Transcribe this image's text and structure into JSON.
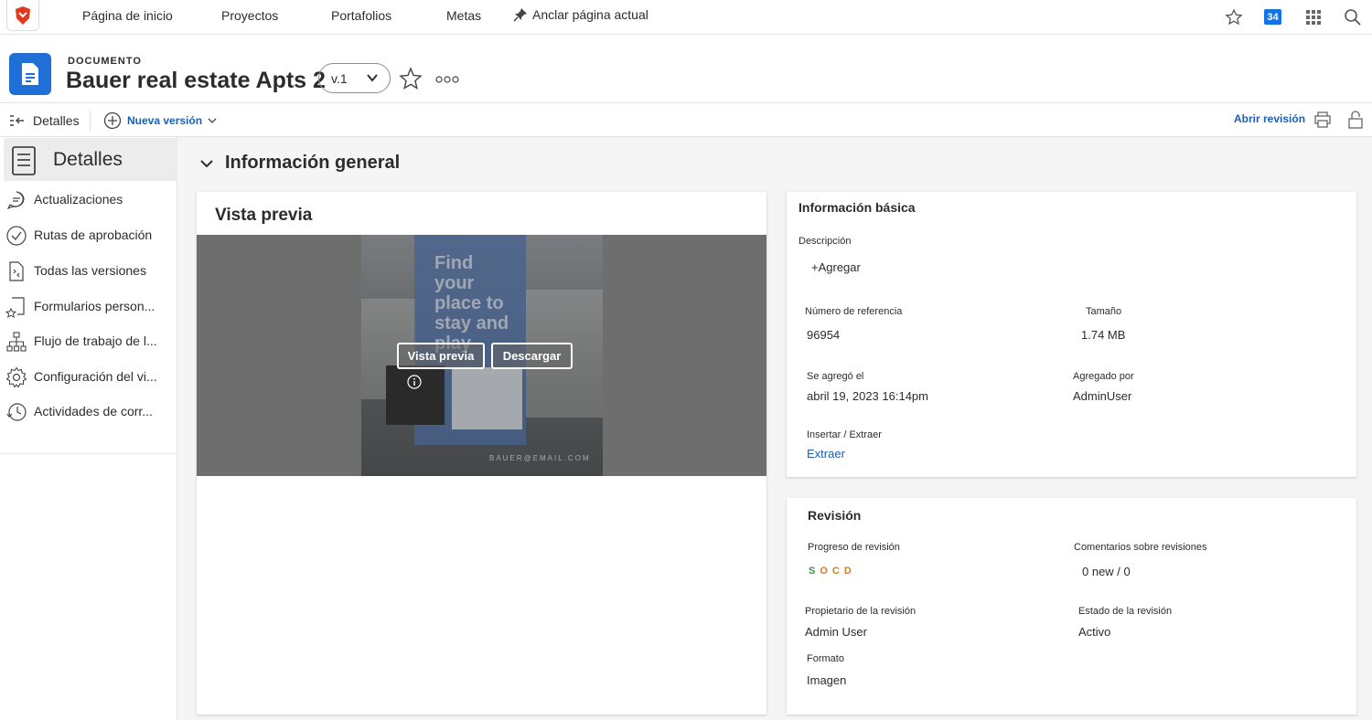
{
  "topnav": {
    "items": [
      "Página de inicio",
      "Proyectos",
      "Portafolios",
      "Metas"
    ],
    "pin_label": "Anclar página actual",
    "badge_count": "34"
  },
  "header": {
    "object_type": "DOCUMENTO",
    "title": "Bauer real estate Apts 2",
    "version": "v.1"
  },
  "toolbar": {
    "details_label": "Detalles",
    "new_version_label": "Nueva versión",
    "open_review_label": "Abrir revisión"
  },
  "sidebar": {
    "active_label": "Detalles",
    "items": [
      {
        "label": "Actualizaciones",
        "icon": "comment-icon"
      },
      {
        "label": "Rutas de aprobación",
        "icon": "check-circle-icon"
      },
      {
        "label": "Todas las versiones",
        "icon": "file-versions-icon"
      },
      {
        "label": "Formularios person...",
        "icon": "custom-form-icon"
      },
      {
        "label": "Flujo de trabajo de l...",
        "icon": "workflow-icon"
      },
      {
        "label": "Configuración del vi...",
        "icon": "gear-icon"
      },
      {
        "label": "Actividades de corr...",
        "icon": "history-icon"
      }
    ]
  },
  "main": {
    "section_title": "Información general",
    "preview": {
      "title": "Vista previa",
      "headline": "Find your place to stay and play",
      "email": "BAUER@EMAIL.COM",
      "preview_button": "Vista previa",
      "download_button": "Descargar"
    },
    "basic_info": {
      "title": "Información básica",
      "description_label": "Descripción",
      "add_label": "+Agregar",
      "ref_label": "Número de referencia",
      "ref_value": "96954",
      "size_label": "Tamaño",
      "size_value": "1.74 MB",
      "added_label": "Se agregó el",
      "added_value": "abril 19, 2023 16:14pm",
      "added_by_label": "Agregado por",
      "added_by_value": "AdminUser",
      "checkin_label": "Insertar / Extraer",
      "checkin_value": "Extraer"
    },
    "review": {
      "title": "Revisión",
      "progress_label": "Progreso de revisión",
      "progress_letters": [
        "S",
        "O",
        "C",
        "D"
      ],
      "comments_label": "Comentarios sobre revisiones",
      "comments_value": "0 new / 0",
      "owner_label": "Propietario de la revisión",
      "owner_value": "Admin User",
      "status_label": "Estado de la revisión",
      "status_value": "Activo",
      "format_label": "Formato",
      "format_value": "Imagen"
    }
  },
  "colors": {
    "accent": "#1473e6",
    "link": "#1a5fb4",
    "doc_icon": "#1f6fd6",
    "socd_s": "#2d9d3a",
    "socd_ocd": "#e07a10"
  }
}
